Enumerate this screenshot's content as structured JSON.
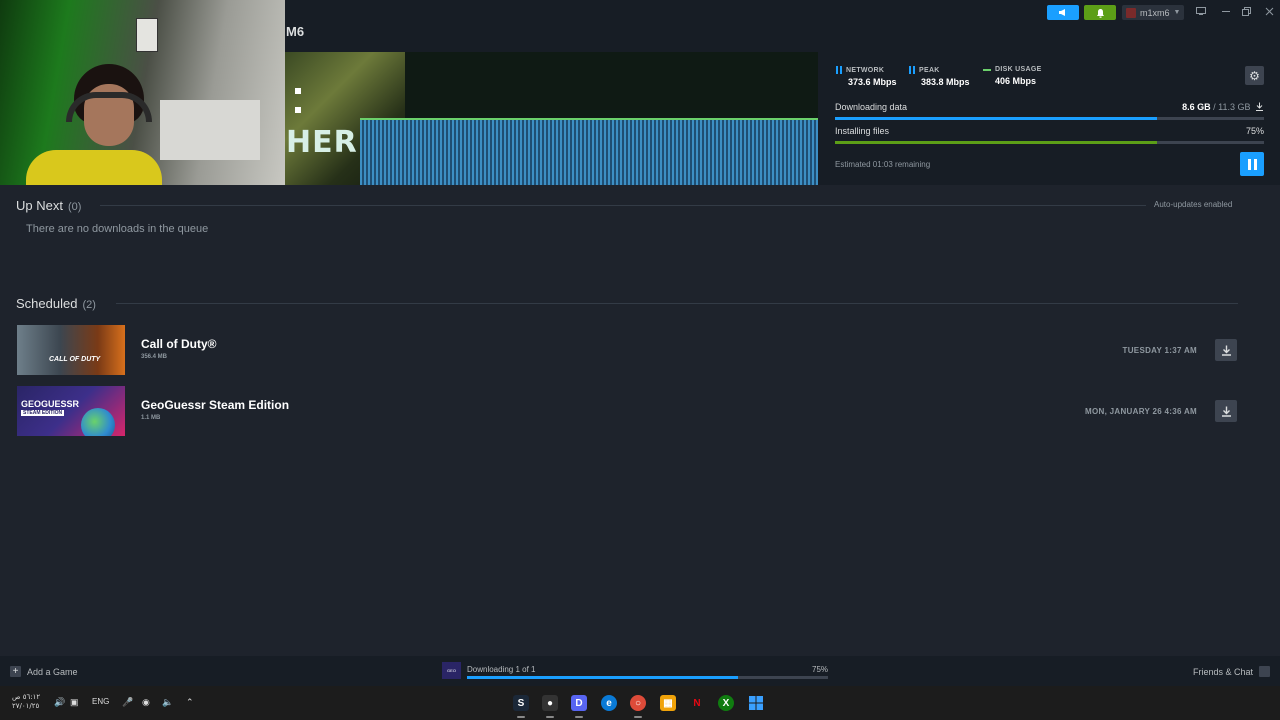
{
  "header": {
    "title": "M6",
    "account_name": "m1xm6",
    "announce_icon": "megaphone-icon",
    "notify_icon": "bell-icon"
  },
  "hero": {
    "letters": "HER"
  },
  "stats": {
    "network": {
      "label": "NETWORK",
      "value": "373.6 Mbps"
    },
    "peak": {
      "label": "PEAK",
      "value": "383.8 Mbps"
    },
    "disk": {
      "label": "DISK USAGE",
      "value": "406 Mbps"
    }
  },
  "progress": {
    "downloading_label": "Downloading data",
    "downloaded": "8.6 GB",
    "total": "/ 11.3 GB",
    "downloading_fraction": 0.75,
    "installing_label": "Installing files",
    "installing_percent": "75%",
    "installing_fraction": 0.75,
    "estimate": "Estimated 01:03 remaining"
  },
  "up_next": {
    "title": "Up Next",
    "count": "(0)",
    "auto_updates": "Auto-updates enabled",
    "empty_text": "There are no downloads in the queue"
  },
  "scheduled": {
    "title": "Scheduled",
    "count": "(2)",
    "items": [
      {
        "name": "Call of Duty®",
        "size": "356.4 MB",
        "time": "TUESDAY 1:37 AM",
        "thumb_text": "CALL OF DUTY"
      },
      {
        "name": "GeoGuessr Steam Edition",
        "size": "1.1 MB",
        "time": "MON, JANUARY 26 4:36 AM",
        "thumb_title": "GEOGUESSR",
        "thumb_sub": "STEAM EDITION"
      }
    ]
  },
  "footer": {
    "add_game": "Add a Game",
    "download_status": "Downloading 1 of 1",
    "download_percent": "75%",
    "download_fraction": 0.75,
    "friends_chat": "Friends & Chat",
    "mini_thumb_text": "GEO"
  },
  "taskbar": {
    "time": "٥٦:١٢ ص",
    "date": "٢٧/٠١/٢٥",
    "language": "ENG"
  },
  "colors": {
    "accent": "#1a9fff",
    "green": "#5c9e17",
    "graph_line": "#6bd06b"
  }
}
